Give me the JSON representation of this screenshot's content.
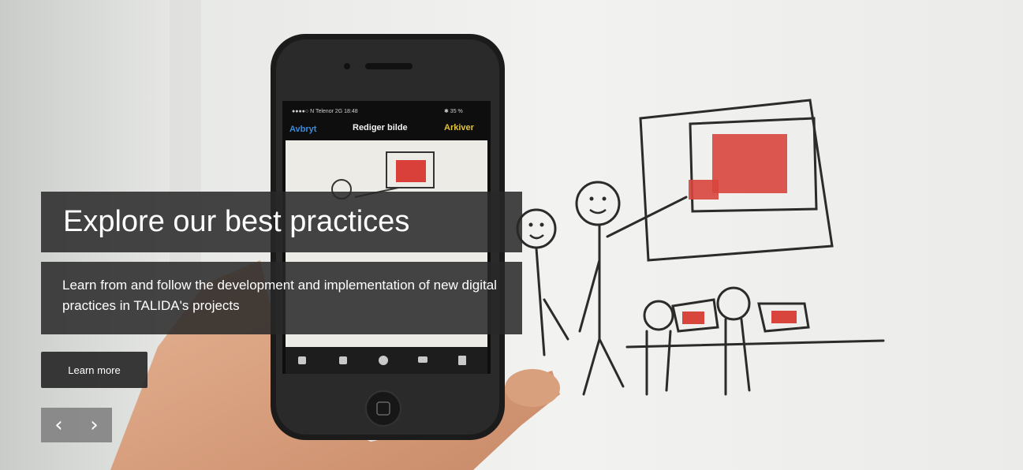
{
  "hero": {
    "title": "Explore our best practices",
    "description": "Learn from and follow the development and implementation of new digital practices in TALIDA's projects",
    "button_label": "Learn more",
    "prev_glyph": "‹",
    "next_glyph": "›"
  },
  "phone": {
    "status_left": "●●●●○ N Telenor  2G   18:48",
    "status_right": "✱ 35 %",
    "cancel_label": "Avbryt",
    "screen_title": "Rediger bilde",
    "save_label": "Arkiver"
  }
}
